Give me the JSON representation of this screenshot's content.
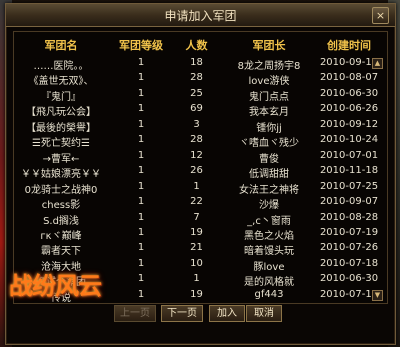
{
  "window": {
    "title": "申请加入军团",
    "close_label": "×"
  },
  "table": {
    "headers": [
      "军团名",
      "军团等级",
      "人数",
      "军团长",
      "创建时间"
    ],
    "rows": [
      [
        "……医院。。",
        "1",
        "18",
        "8龙之周扬宇8",
        "2010-09-11"
      ],
      [
        "《盖世无双》、",
        "1",
        "28",
        "love游侠",
        "2010-08-07"
      ],
      [
        "『鬼门』",
        "1",
        "25",
        "鬼门点点",
        "2010-06-30"
      ],
      [
        "【飛凡玩公会】",
        "1",
        "69",
        "我本玄月",
        "2010-06-26"
      ],
      [
        "【最後的榮譽】",
        "1",
        "3",
        "锺你jj",
        "2010-09-12"
      ],
      [
        "☰死亡契约☰",
        "1",
        "28",
        "ヾ嗜血ヾ残少",
        "2010-10-24"
      ],
      [
        "→曹军←",
        "1",
        "12",
        "曹俊",
        "2010-07-01"
      ],
      [
        "￥￥姑娘漂亮￥￥",
        "1",
        "26",
        "低调甜甜",
        "2010-11-18"
      ],
      [
        "0龙骑士之战神0",
        "1",
        "1",
        "女法王之神将",
        "2010-07-25"
      ],
      [
        "chess影",
        "1",
        "22",
        "沙爆",
        "2010-09-07"
      ],
      [
        "S.d搁浅",
        "1",
        "7",
        "_,c丶窗雨",
        "2010-08-28"
      ],
      [
        "гκヾ巅峰",
        "1",
        "19",
        "黑色之火焰",
        "2010-07-19"
      ],
      [
        "霸者天下",
        "1",
        "21",
        "暗着馒头玩",
        "2010-07-26"
      ],
      [
        "沧海大地",
        "1",
        "10",
        "豚love",
        "2010-07-18"
      ],
      [
        "测试个军团",
        "1",
        "1",
        "是的风格就",
        "2010-06-30"
      ],
      [
        "传说",
        "1",
        "19",
        "gf443",
        "2010-07-18"
      ]
    ]
  },
  "scroll": {
    "up_label": "▲",
    "down_label": "▼"
  },
  "buttons": {
    "prev": "上一页",
    "next": "下一页",
    "join": "加入",
    "cancel": "取消"
  },
  "logo": {
    "text": "战纷风云"
  }
}
